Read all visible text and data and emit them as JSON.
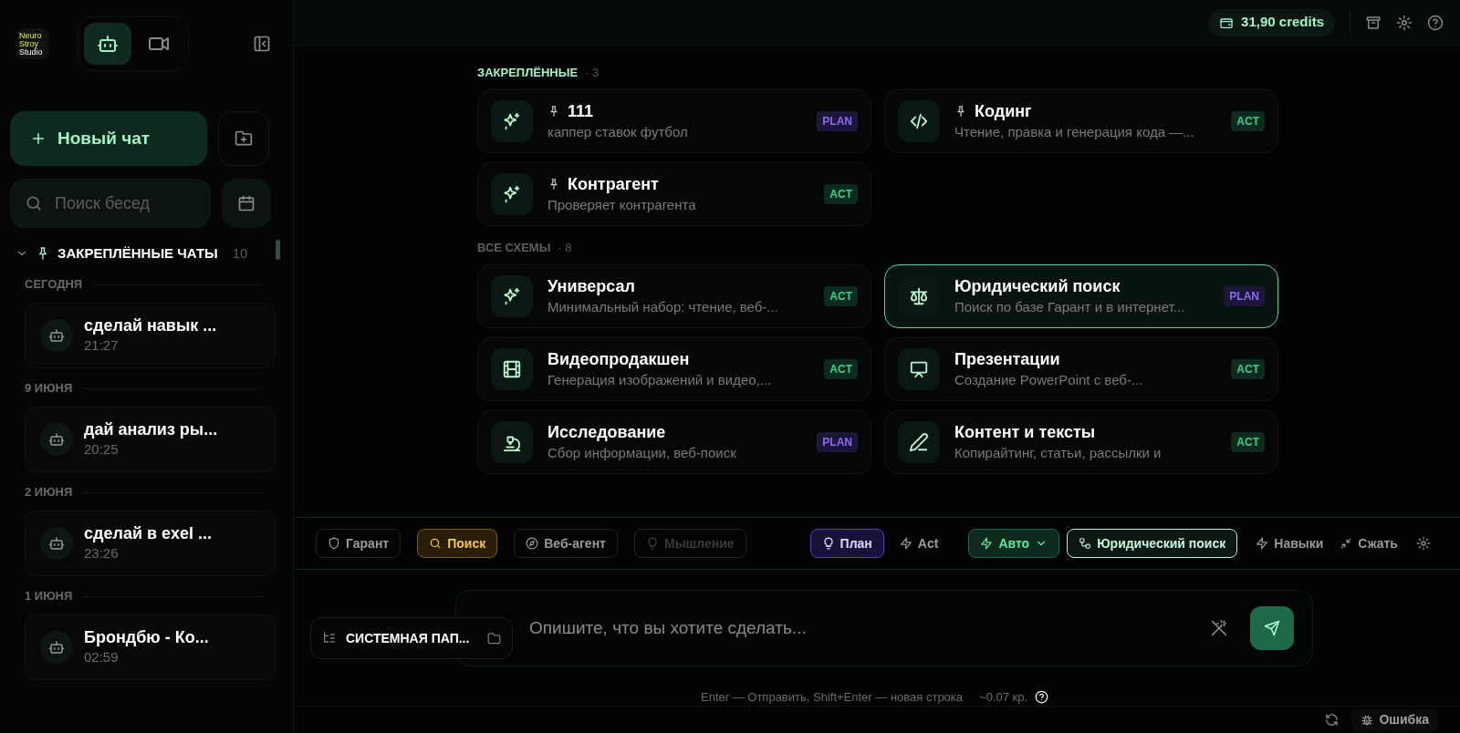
{
  "sidebar": {
    "logo": [
      "Neuro",
      "Stroy",
      "Studio"
    ],
    "mode_tabs": [
      {
        "kind": "bot",
        "selected": true
      },
      {
        "kind": "video",
        "selected": false
      }
    ],
    "new_chat": "Новый чат",
    "search": {
      "placeholder": "Поиск бесед"
    },
    "pinned_section": {
      "title": "ЗАКРЕПЛЁННЫЕ ЧАТЫ",
      "count": "10",
      "expanded": true
    },
    "groups": [
      {
        "date": "СЕГОДНЯ",
        "chats": [
          {
            "title": "сделай навык ...",
            "time": "21:27"
          }
        ]
      },
      {
        "date": "9 ИЮНЯ",
        "chats": [
          {
            "title": "дай анализ ры...",
            "time": "20:25"
          }
        ]
      },
      {
        "date": "2 ИЮНЯ",
        "chats": [
          {
            "title": "сделай в exel ...",
            "time": "23:26"
          }
        ]
      },
      {
        "date": "1 ИЮНЯ",
        "chats": [
          {
            "title": "Брондбю - Ко...",
            "time": "02:59"
          }
        ]
      }
    ]
  },
  "header": {
    "credits": "31,90 credits"
  },
  "sections": [
    {
      "title": "ЗАКРЕПЛЁННЫЕ",
      "count": "· 3",
      "cards": [
        {
          "kind": "sparkle",
          "pinned": true,
          "title": "111",
          "description": "каппер ставок футбол",
          "mode": "PLAN",
          "selected": false
        },
        {
          "kind": "code",
          "pinned": true,
          "title": "Кодинг",
          "description": "Чтение, правка и генерация кода —...",
          "mode": "ACT",
          "selected": false
        },
        {
          "kind": "sparkle",
          "pinned": true,
          "title": "Контрагент",
          "description": "Проверяет контрагента",
          "mode": "ACT",
          "selected": false
        }
      ]
    },
    {
      "title": "ВСЕ СХЕМЫ",
      "count": "· 8",
      "cards": [
        {
          "kind": "sparkle",
          "pinned": false,
          "title": "Универсал",
          "description": "Минимальный набор: чтение, веб-...",
          "mode": "ACT",
          "selected": false
        },
        {
          "kind": "scales",
          "pinned": false,
          "title": "Юридический поиск",
          "description": "Поиск по базе Гарант и в интернет...",
          "mode": "PLAN",
          "selected": true
        },
        {
          "kind": "film",
          "pinned": false,
          "title": "Видеопродакшен",
          "description": "Генерация изображений и видео,...",
          "mode": "ACT",
          "selected": false
        },
        {
          "kind": "presentation",
          "pinned": false,
          "title": "Презентации",
          "description": "Создание PowerPoint с веб-...",
          "mode": "ACT",
          "selected": false
        },
        {
          "kind": "microscope",
          "pinned": false,
          "title": "Исследование",
          "description": "Сбор информации, веб-поиск",
          "mode": "PLAN",
          "selected": false
        },
        {
          "kind": "pen",
          "pinned": false,
          "title": "Контент и тексты",
          "description": "Копирайтинг, статьи, рассылки и",
          "mode": "ACT",
          "selected": false
        }
      ]
    }
  ],
  "toolbar": {
    "tools": [
      {
        "kind": "shield",
        "label": "Гарант",
        "on": false,
        "disabled": false
      },
      {
        "kind": "search",
        "label": "Поиск",
        "on": true,
        "disabled": false
      },
      {
        "kind": "compass",
        "label": "Веб-агент",
        "on": false,
        "disabled": false
      },
      {
        "kind": "bulb",
        "label": "Мышление",
        "on": false,
        "disabled": true
      }
    ],
    "modes": [
      {
        "kind": "bulb",
        "label": "План",
        "selected": true
      },
      {
        "kind": "bolt",
        "label": "Act",
        "selected": false
      }
    ],
    "model": "Авто",
    "scheme": "Юридический поиск",
    "actions": [
      {
        "kind": "bolt",
        "label": "Навыки"
      },
      {
        "kind": "shrink",
        "label": "Сжать"
      }
    ]
  },
  "composer": {
    "folder": "СИСТЕМНАЯ ПАП...",
    "placeholder": "Опишите, что вы хотите сделать...",
    "hint": "Enter — Отправить, Shift+Enter — новая строка",
    "cost": "~0.07 кр."
  },
  "status_bar": {
    "error": "Ошибка"
  }
}
